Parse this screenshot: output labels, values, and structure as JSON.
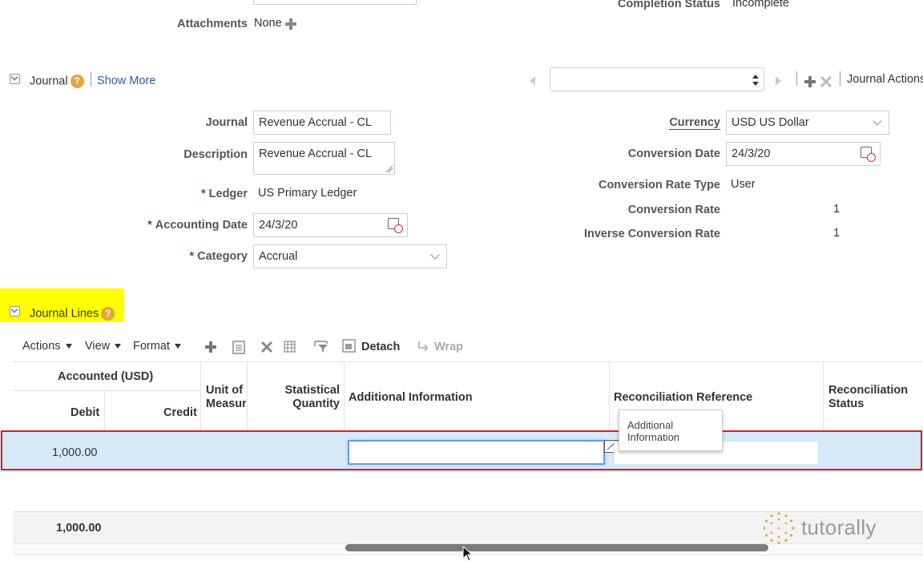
{
  "header": {
    "attachments_label": "Attachments",
    "attachments_value": "None",
    "completion_status_label": "Completion Status",
    "completion_status_value": "Incomplete"
  },
  "journal_section": {
    "title": "Journal",
    "help": "?",
    "show_more": "Show More",
    "actions_label": "Journal Actions",
    "fields": {
      "journal_label": "Journal",
      "journal_value": "Revenue Accrual - CL",
      "description_label": "Description",
      "description_value": "Revenue Accrual - CL",
      "ledger_label": "Ledger",
      "ledger_value": "US Primary Ledger",
      "accounting_date_label": "Accounting Date",
      "accounting_date_value": "24/3/20",
      "category_label": "Category",
      "category_value": "Accrual",
      "currency_label": "Currency",
      "currency_value": "USD US Dollar",
      "conversion_date_label": "Conversion Date",
      "conversion_date_value": "24/3/20",
      "conversion_rate_type_label": "Conversion Rate Type",
      "conversion_rate_type_value": "User",
      "conversion_rate_label": "Conversion Rate",
      "conversion_rate_value": "1",
      "inverse_conversion_rate_label": "Inverse Conversion Rate",
      "inverse_conversion_rate_value": "1"
    },
    "required_mark": "*"
  },
  "journal_lines": {
    "title": "Journal Lines",
    "help": "?",
    "toolbar": {
      "actions": "Actions",
      "view": "View",
      "format": "Format",
      "detach": "Detach",
      "wrap": "Wrap"
    },
    "columns": {
      "accounted_group": "Accounted (USD)",
      "debit": "Debit",
      "credit": "Credit",
      "unit_of_measure_1": "Unit of",
      "unit_of_measure_2": "Measur",
      "statistical_quantity_1": "Statistical",
      "statistical_quantity_2": "Quantity",
      "additional_information": "Additional Information",
      "reconciliation_reference": "Reconciliation Reference",
      "reconciliation_status_1": "Reconciliation",
      "reconciliation_status_2": "Status"
    },
    "rows": [
      {
        "debit": "1,000.00",
        "credit": "",
        "additional_information": "",
        "reconciliation_reference": ""
      }
    ],
    "total_debit": "1,000.00",
    "tooltip_line1": "Additional",
    "tooltip_line2": "Information"
  },
  "watermark": "tutorally",
  "colors": {
    "highlight_yellow": "#ffff00",
    "row_selected": "#d6e9f8",
    "red_box": "#e21b23",
    "link": "#2c5aa0",
    "help_orange": "#e8a33a"
  }
}
